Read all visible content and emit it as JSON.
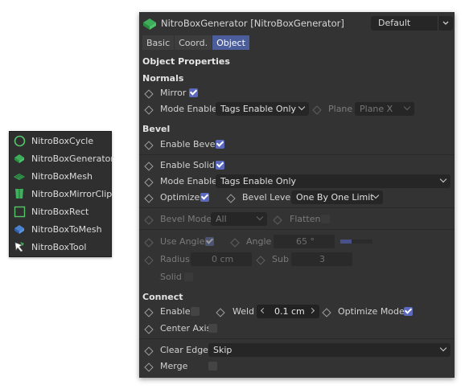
{
  "menu": {
    "items": [
      {
        "label": "NitroBoxCycle",
        "icon": "circle-icon"
      },
      {
        "label": "NitroBoxGenerator",
        "icon": "generator-icon"
      },
      {
        "label": "NitroBoxMesh",
        "icon": "mesh-icon"
      },
      {
        "label": "NitroBoxMirrorClip",
        "icon": "mirror-clip-icon"
      },
      {
        "label": "NitroBoxRect",
        "icon": "rect-icon"
      },
      {
        "label": "NitroBoxToMesh",
        "icon": "to-mesh-icon"
      },
      {
        "label": "NitroBoxTool",
        "icon": "tool-icon"
      }
    ]
  },
  "panel": {
    "title": "NitroBoxGenerator [NitroBoxGenerator]",
    "preset": "Default",
    "tabs": [
      {
        "label": "Basic",
        "active": false
      },
      {
        "label": "Coord.",
        "active": false
      },
      {
        "label": "Object",
        "active": true
      }
    ],
    "section_title": "Object Properties",
    "normals": {
      "title": "Normals",
      "mirror_label": "Mirror",
      "mode_enable_label": "Mode Enable",
      "mode_enable_value": "Tags Enable Only",
      "plane_label": "Plane",
      "plane_value": "Plane X"
    },
    "bevel": {
      "title": "Bevel",
      "enable_bevel_label": "Enable Bevel",
      "enable_solid_label": "Enable Solid",
      "mode_enable_label": "Mode Enable",
      "mode_enable_value": "Tags Enable Only",
      "optimize_label": "Optimize",
      "bevel_level_label": "Bevel Level",
      "bevel_level_value": "One By One Limit",
      "bevel_mode_label": "Bevel Mode",
      "bevel_mode_value": "All",
      "flatten_label": "Flatten",
      "use_angle_label": "Use Angle",
      "angle_label": "Angle",
      "angle_value": "65 °",
      "angle_fraction": 0.36,
      "radius_label": "Radius",
      "radius_value": "0 cm",
      "sub_label": "Sub",
      "sub_value": "3",
      "solid_label": "Solid"
    },
    "connect": {
      "title": "Connect",
      "enable_label": "Enable",
      "weld_label": "Weld",
      "weld_value": "0.1 cm",
      "optimize_mode_label": "Optimize Mode",
      "center_axis_label": "Center Axis",
      "clear_edge_label": "Clear Edge",
      "clear_edge_value": "Skip",
      "merge_label": "Merge"
    }
  },
  "colors": {
    "accent": "#5b6abf",
    "panel_bg": "#333333",
    "tab_active": "#4c5d9c"
  }
}
